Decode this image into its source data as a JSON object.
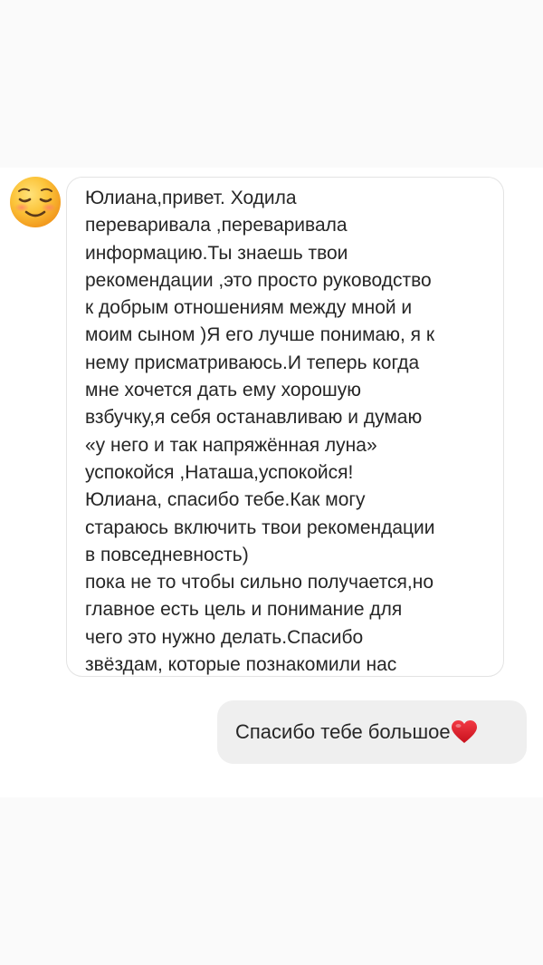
{
  "conversation": {
    "incoming": {
      "avatar_icon": "smiling-face-emoji-icon",
      "text": "Юлиана,привет. Ходила\nпереваривала ,переваривала\nинформацию.Ты знаешь твои\nрекомендации ,это просто руководство\nк добрым отношениям между мной и\nмоим сыном )Я его лучше понимаю, я к\nнему присматриваюсь.И теперь когда\nмне хочется дать ему хорошую\nвзбучку,я себя останавливаю и думаю\n«у него и так напряжённая луна»\nуспокойся ,Наташа,успокойся!\nЮлиана, спасибо тебе.Как могу\nстараюсь включить твои рекомендации\nв повседневность)\nпока не то чтобы сильно получается,но\nглавное есть цель и понимание для\nчего это нужно делать.Спасибо\nзвёздам, которые познакомили нас"
    },
    "outgoing": {
      "text": "Спасибо тебе большое",
      "emoji_icon": "red-heart-icon"
    }
  },
  "colors": {
    "page_background": "#fafafa",
    "chat_background": "#ffffff",
    "incoming_bubble": "#ffffff",
    "incoming_border": "#e3e3e3",
    "outgoing_bubble": "#efefef",
    "text": "#262626",
    "heart": "#e0232e"
  }
}
